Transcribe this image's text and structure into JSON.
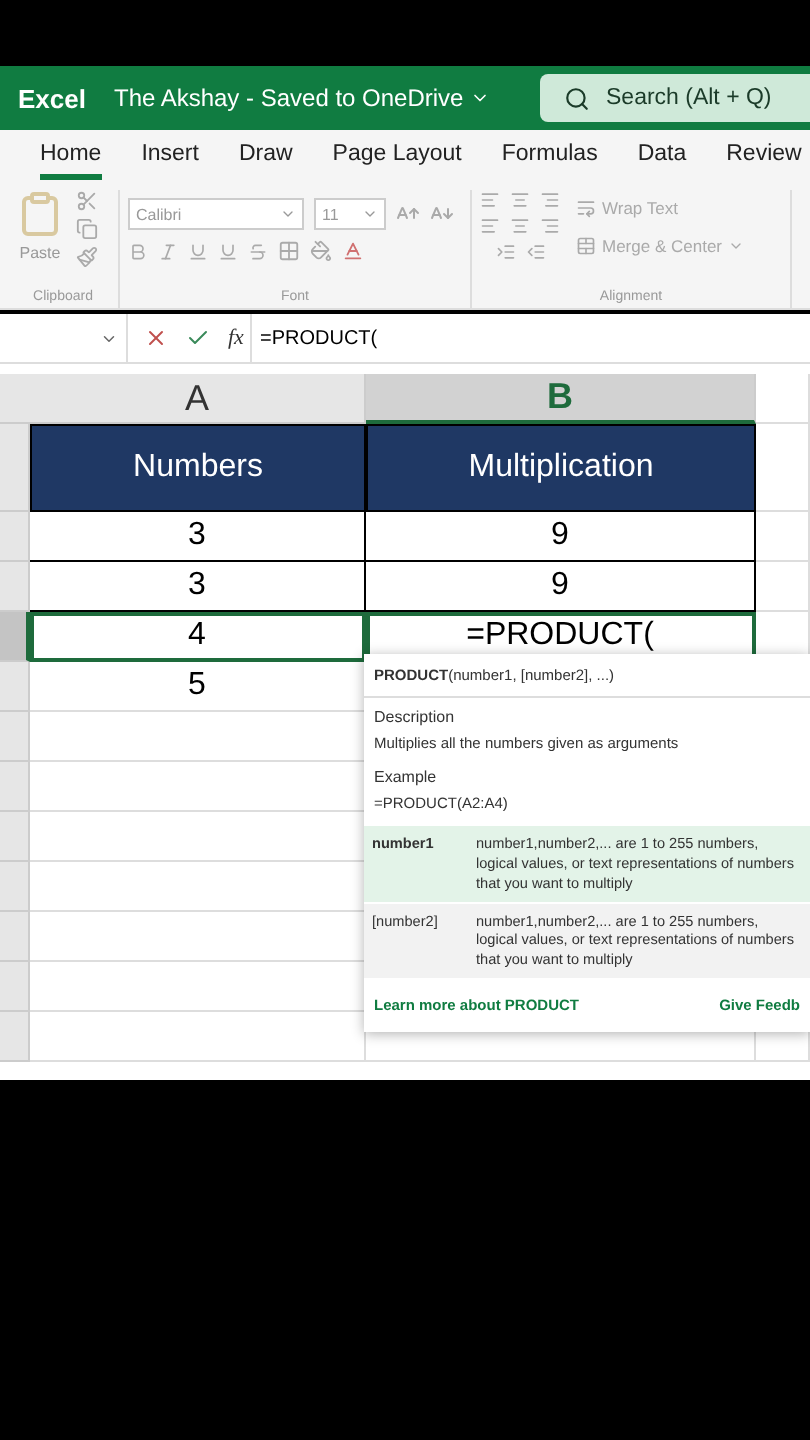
{
  "app_title": "Excel",
  "document": {
    "title": "The Akshay  -  Saved to OneDrive"
  },
  "search": {
    "placeholder": "Search (Alt + Q)"
  },
  "ribbon_tabs": [
    {
      "label": "Home",
      "selected": true
    },
    {
      "label": "Insert",
      "selected": false
    },
    {
      "label": "Draw",
      "selected": false
    },
    {
      "label": "Page Layout",
      "selected": false
    },
    {
      "label": "Formulas",
      "selected": false
    },
    {
      "label": "Data",
      "selected": false
    },
    {
      "label": "Review",
      "selected": false
    }
  ],
  "ribbon": {
    "clipboard": {
      "paste_label": "Paste",
      "group_label": "Clipboard"
    },
    "font": {
      "font_name": "Calibri",
      "font_size": "11",
      "group_label": "Font"
    },
    "alignment": {
      "wrap_text": "Wrap Text",
      "merge_center": "Merge & Center",
      "group_label": "Alignment"
    }
  },
  "formula_bar": {
    "function_label": "fx",
    "value": "=PRODUCT("
  },
  "columns": [
    {
      "label": "A",
      "selected": false
    },
    {
      "label": "B",
      "selected": true
    }
  ],
  "header_row": [
    "Numbers",
    "Multiplication"
  ],
  "rows": [
    {
      "cells": [
        "3",
        "9"
      ],
      "selected": false
    },
    {
      "cells": [
        "3",
        "9"
      ],
      "selected": false
    },
    {
      "cells": [
        "4",
        "=PRODUCT("
      ],
      "selected": true
    },
    {
      "cells": [
        "5",
        ""
      ],
      "selected": false
    }
  ],
  "tooltip": {
    "signature": "**PRODUCT**(number1, [number2], ...)",
    "description_heading": "Description",
    "description": "Multiplies all the numbers given as arguments",
    "example_heading": "Example",
    "example": "=PRODUCT(A2:A4)",
    "arguments": [
      {
        "name": "number1",
        "text": "number1,number2,... are 1 to 255 numbers, logical values, or text representations of numbers that you want to multiply",
        "selected": true
      },
      {
        "name": "[number2]",
        "text": "number1,number2,... are 1 to 255 numbers, logical values, or text representations of numbers that you want to multiply",
        "selected": false
      }
    ],
    "learn_more": "Learn more about PRODUCT",
    "feedback": "Give Feedb"
  }
}
